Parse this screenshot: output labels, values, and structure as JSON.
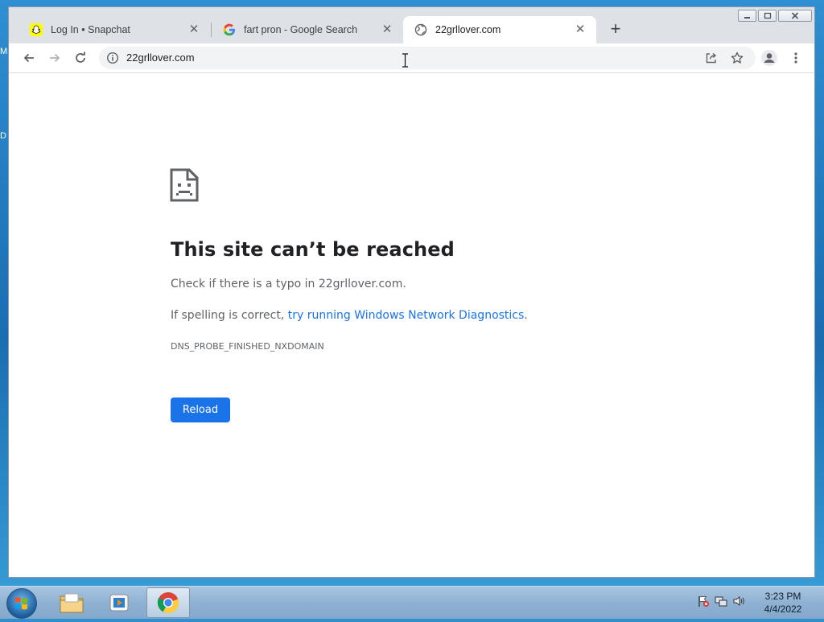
{
  "desktop": {
    "left_edge_labels": [
      "M",
      "D"
    ]
  },
  "browser": {
    "tabs": [
      {
        "title": "Log In • Snapchat",
        "favicon": "snapchat-icon",
        "active": false
      },
      {
        "title": "fart pron - Google Search",
        "favicon": "google-icon",
        "active": false
      },
      {
        "title": "22grllover.com",
        "favicon": "globe-icon",
        "active": true
      }
    ],
    "new_tab_symbol": "+",
    "close_tab_symbol": "✕",
    "address": {
      "url": "22grllover.com"
    }
  },
  "error_page": {
    "title": "This site can’t be reached",
    "line1": "Check if there is a typo in 22grllover.com.",
    "line2_prefix": "If spelling is correct, ",
    "line2_link": "try running Windows Network Diagnostics",
    "line2_suffix": ".",
    "error_code": "DNS_PROBE_FINISHED_NXDOMAIN",
    "reload_label": "Reload"
  },
  "taskbar": {
    "items": [
      "start-button",
      "file-explorer-icon",
      "media-player-icon",
      "chrome-icon"
    ],
    "clock": {
      "time": "3:23 PM",
      "date": "4/4/2022"
    }
  },
  "colors": {
    "link": "#1a73e8",
    "reload_button": "#1a73e8",
    "title_text": "#202124",
    "body_text": "#5f6368"
  }
}
